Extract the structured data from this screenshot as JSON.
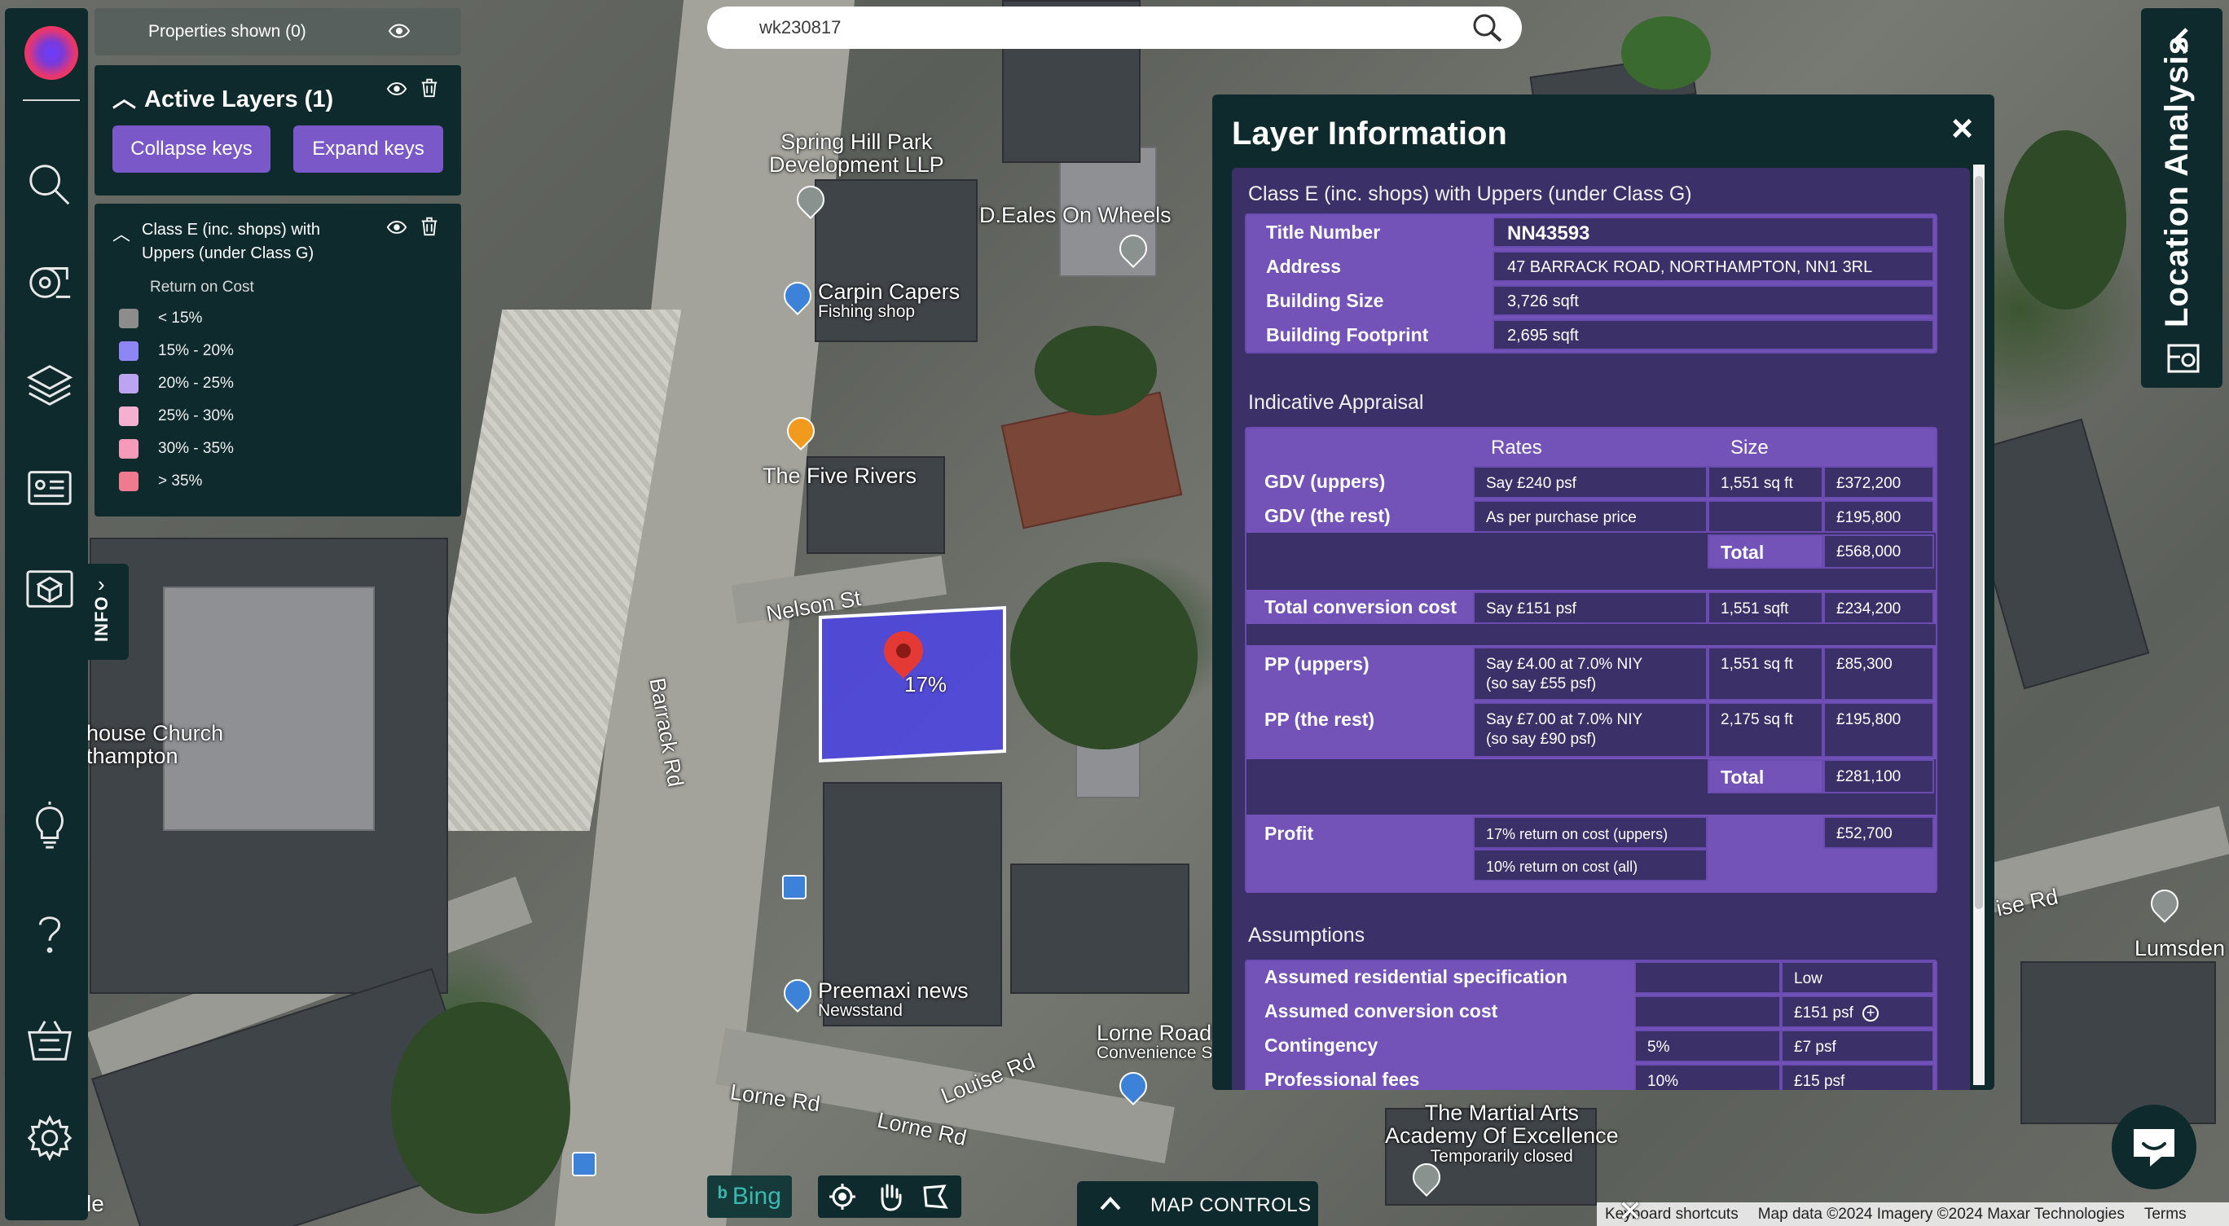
{
  "search": {
    "value": "wk230817"
  },
  "properties_bar": {
    "label": "Properties shown (0)"
  },
  "layers_panel": {
    "title": "Active Layers (1)",
    "collapse_label": "Collapse keys",
    "expand_label": "Expand keys"
  },
  "legend": {
    "layer_name": "Class E (inc. shops) with Uppers (under Class G)",
    "subtitle": "Return on Cost",
    "items": [
      {
        "label": "< 15%",
        "color": "#8c8c8c"
      },
      {
        "label": "15% - 20%",
        "color": "#8e86f2"
      },
      {
        "label": "20% - 25%",
        "color": "#bca4f0"
      },
      {
        "label": "25% - 30%",
        "color": "#f5b0d0"
      },
      {
        "label": "30% - 35%",
        "color": "#f59ab8"
      },
      {
        "label": "> 35%",
        "color": "#f07a8e"
      }
    ]
  },
  "info_tab": {
    "label": "INFO"
  },
  "location_analysis": {
    "label": "Location Analysis"
  },
  "map": {
    "property_label": "17%",
    "labels": {
      "spring_hill": "Spring Hill Park",
      "spring_hill_2": "Development LLP",
      "deales": "D.Eales On Wheels",
      "carpin": "Carpin Capers",
      "carpin_sub": "Fishing shop",
      "five_rivers": "The Five Rivers",
      "nelson": "Nelson St",
      "barrack": "Barrack Rd",
      "church": "house Church",
      "church_2": "thampton",
      "preemaxi": "Preemaxi news",
      "preemaxi_sub": "Newsstand",
      "lorne_road": "Lorne Road",
      "lorne_road_sub": "Convenience S",
      "lorne_rd_1": "Lorne Rd",
      "lorne_rd_2": "Lorne Rd",
      "louise": "Louise Rd",
      "martial": "The Martial Arts",
      "martial_2": "Academy Of Excellence",
      "martial_sub": "Temporarily closed",
      "ise_rd": "ise Rd",
      "lumsden": "Lumsden",
      "google_frag": "le"
    }
  },
  "layer_info": {
    "title": "Layer Information",
    "close": "×",
    "layer_name": "Class E (inc. shops) with Uppers (under Class G)",
    "property": [
      {
        "key": "Title Number",
        "value": "NN43593"
      },
      {
        "key": "Address",
        "value": "47 BARRACK ROAD, NORTHAMPTON, NN1 3RL"
      },
      {
        "key": "Building Size",
        "value": "3,726 sqft"
      },
      {
        "key": "Building Footprint",
        "value": "2,695 sqft"
      }
    ],
    "appraisal_title": "Indicative Appraisal",
    "appraisal": {
      "header_rates": "Rates",
      "header_size": "Size",
      "gdv_uppers": {
        "label": "GDV (uppers)",
        "rate": "Say £240 psf",
        "size": "1,551 sq ft",
        "value": "£372,200"
      },
      "gdv_rest": {
        "label": "GDV (the rest)",
        "rate": "As per purchase price",
        "size": "",
        "value": "£195,800"
      },
      "gdv_total": {
        "label": "Total",
        "value": "£568,000"
      },
      "conversion": {
        "label": "Total conversion cost",
        "rate": "Say £151 psf",
        "size": "1,551 sqft",
        "value": "£234,200"
      },
      "pp_uppers": {
        "label": "PP (uppers)",
        "rate_1": "Say £4.00 at 7.0% NIY",
        "rate_2": "(so say £55 psf)",
        "size": "1,551 sq ft",
        "value": "£85,300"
      },
      "pp_rest": {
        "label": "PP (the rest)",
        "rate_1": "Say £7.00 at 7.0% NIY",
        "rate_2": "(so say £90 psf)",
        "size": "2,175 sq ft",
        "value": "£195,800"
      },
      "pp_total": {
        "label": "Total",
        "value": "£281,100"
      },
      "profit": {
        "label": "Profit",
        "rate_1": "17% return on cost (uppers)",
        "rate_2": "10% return on cost (all)",
        "value": "£52,700"
      }
    },
    "assumptions_title": "Assumptions",
    "assumptions": [
      {
        "label": "Assumed residential specification",
        "mid": "",
        "value": "Low"
      },
      {
        "label": "Assumed conversion cost",
        "mid": "",
        "value": "£151 psf"
      },
      {
        "label": "Contingency",
        "mid": "5%",
        "value": "£7 psf"
      },
      {
        "label": "Professional fees",
        "mid": "10%",
        "value": "£15 psf"
      }
    ]
  },
  "bottom": {
    "bing": "Bing",
    "map_controls": "MAP CONTROLS",
    "attribution": {
      "shortcuts": "Keyboard shortcuts",
      "data": "Map data ©2024 Imagery ©2024 Maxar Technologies",
      "terms": "Terms"
    }
  },
  "colors": {
    "panel_dark": "#0e2a2d",
    "accent_purple": "#7353b8",
    "table_bg": "#3b3168"
  }
}
